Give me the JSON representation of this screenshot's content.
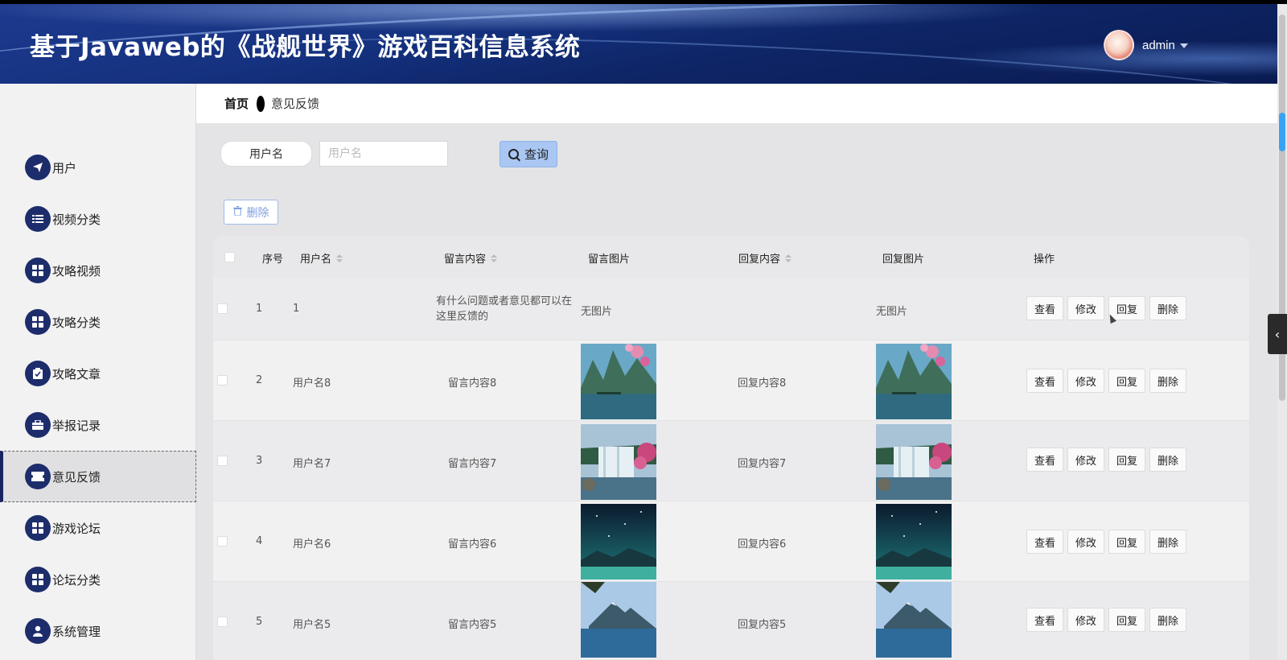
{
  "app": {
    "title": "基于Javaweb的《战舰世界》游戏百科信息系统",
    "user_name": "admin"
  },
  "sidebar": {
    "items": [
      {
        "label": "用户",
        "icon": "paper-plane-icon"
      },
      {
        "label": "视频分类",
        "icon": "list-icon"
      },
      {
        "label": "攻略视频",
        "icon": "grid-icon"
      },
      {
        "label": "攻略分类",
        "icon": "grid-icon"
      },
      {
        "label": "攻略文章",
        "icon": "clipboard-icon"
      },
      {
        "label": "举报记录",
        "icon": "briefcase-icon"
      },
      {
        "label": "意见反馈",
        "icon": "ticket-icon",
        "active": true
      },
      {
        "label": "游戏论坛",
        "icon": "grid-icon"
      },
      {
        "label": "论坛分类",
        "icon": "grid-icon"
      },
      {
        "label": "系统管理",
        "icon": "person-icon"
      }
    ]
  },
  "breadcrumb": {
    "home": "首页",
    "current": "意见反馈"
  },
  "search": {
    "label": "用户名",
    "placeholder": "用户名",
    "button": "查询"
  },
  "toolbar": {
    "delete_label": "删除"
  },
  "table": {
    "headers": {
      "index": "序号",
      "username": "用户名",
      "content": "留言内容",
      "image": "留言图片",
      "reply": "回复内容",
      "reply_image": "回复图片",
      "actions": "操作"
    },
    "actions": {
      "view": "查看",
      "edit": "修改",
      "reply": "回复",
      "delete": "删除"
    },
    "rows": [
      {
        "index": "1",
        "username": "1",
        "content": "有什么问题或者意见都可以在这里反馈的",
        "image": "无图片",
        "reply": "",
        "reply_image": "无图片",
        "picture": null
      },
      {
        "index": "2",
        "username": "用户名8",
        "content": "留言内容8",
        "reply": "回复内容8",
        "picture": "mountain-lake-blossom"
      },
      {
        "index": "3",
        "username": "用户名7",
        "content": "留言内容7",
        "reply": "回复内容7",
        "picture": "waterfall"
      },
      {
        "index": "4",
        "username": "用户名6",
        "content": "留言内容6",
        "reply": "回复内容6",
        "picture": "starry-night-lake"
      },
      {
        "index": "5",
        "username": "用户名5",
        "content": "留言内容5",
        "reply": "回复内容5",
        "picture": "lake-mountain-day"
      }
    ]
  },
  "colors": {
    "header_bg": "#153280",
    "menu_icon_bg": "#1d2d6b",
    "search_button_bg": "#a9c7f2",
    "scroll_accent": "#38a3f5"
  }
}
